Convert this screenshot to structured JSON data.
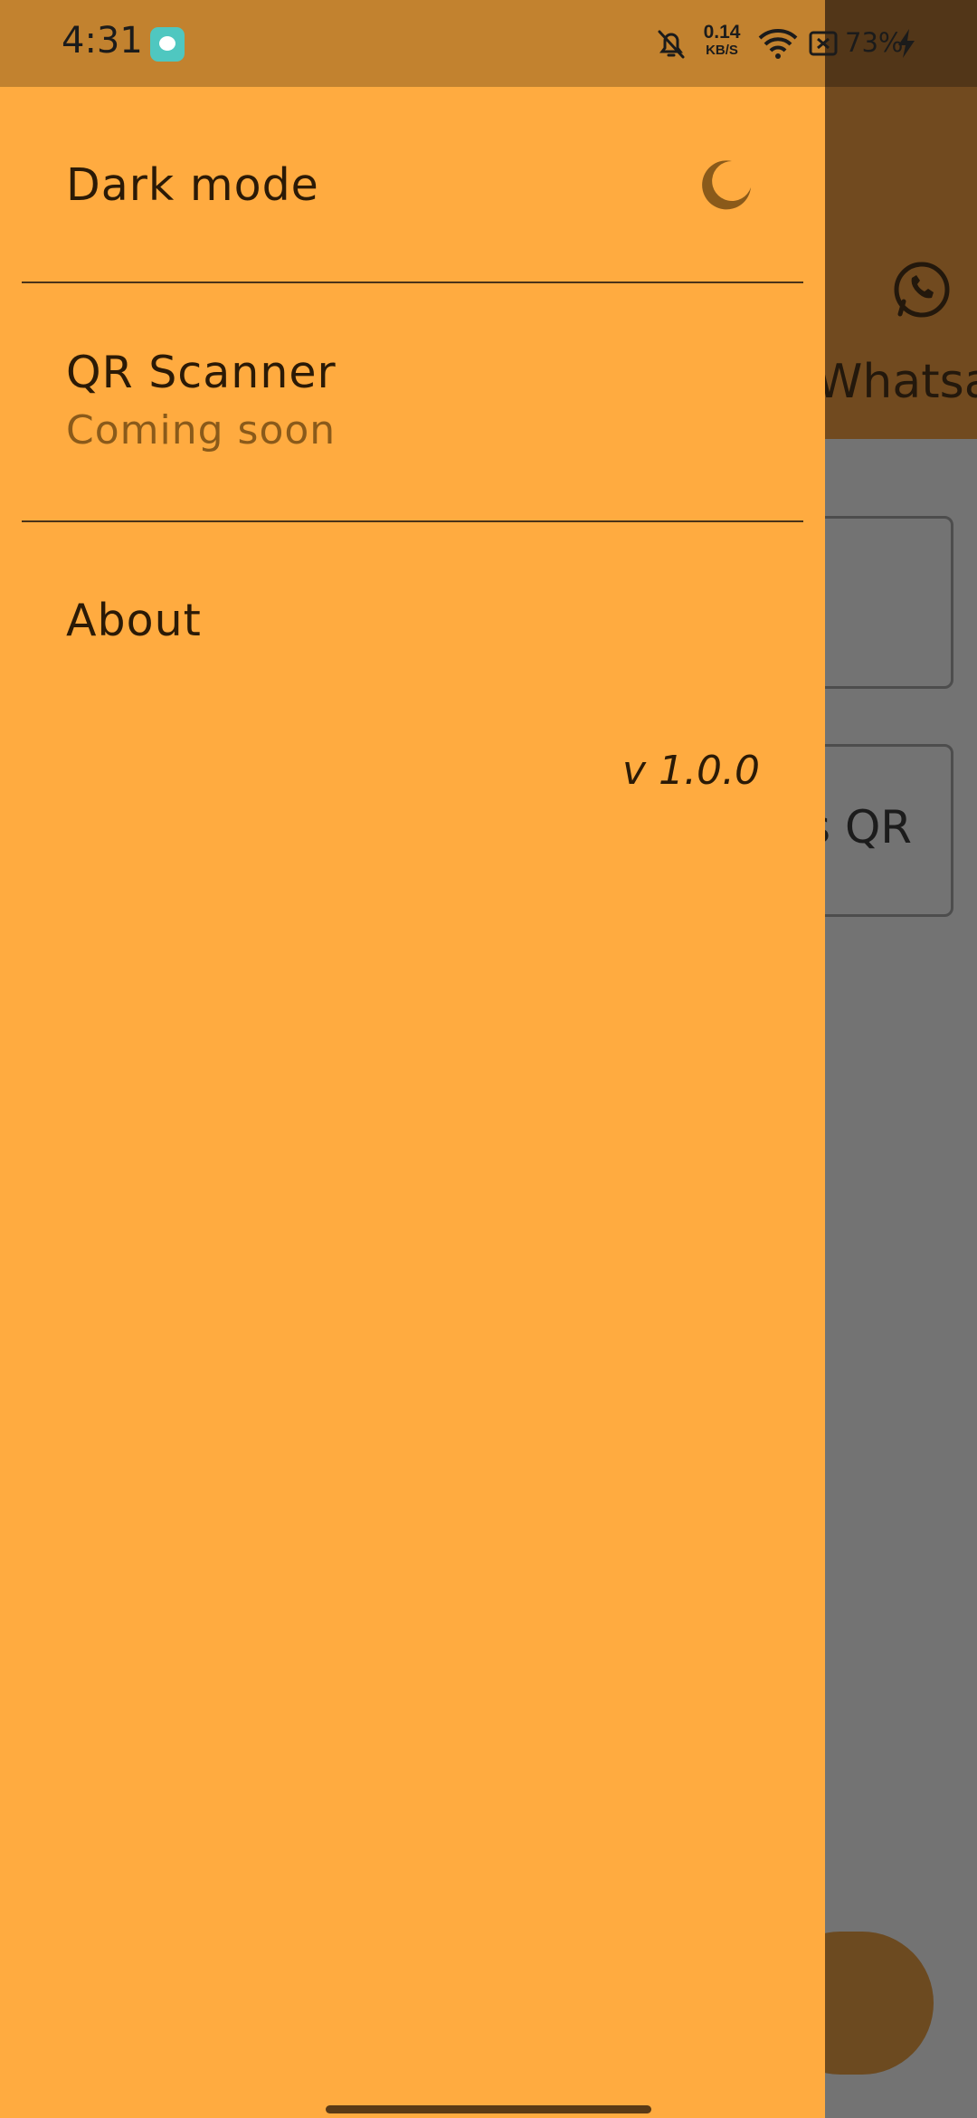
{
  "status_bar": {
    "time": "4:31",
    "app_icon": "screen-recorder-icon",
    "bell_icon": "bell-off-icon",
    "net_speed_value": "0.14",
    "net_speed_unit": "KB/S",
    "wifi_icon": "wifi-icon",
    "battery_saver_icon": "battery-x-icon",
    "battery": "73%",
    "charging_icon": "bolt-icon"
  },
  "background": {
    "appbar_tab_label": "Whatsa",
    "appbar_tab_icon": "whatsapp-icon",
    "card_label": "s QR"
  },
  "drawer": {
    "items": [
      {
        "title": "Dark mode",
        "icon": "moon-icon"
      },
      {
        "title": "QR Scanner",
        "subtitle": "Coming soon"
      },
      {
        "title": "About"
      }
    ],
    "version": "v 1.0.0"
  },
  "colors": {
    "drawer_bg": "#ffab40",
    "status_bar": "#c2822f",
    "scrim_bg": "#737373",
    "text_primary": "#2b1a06",
    "text_secondary": "#8a5a1a"
  }
}
